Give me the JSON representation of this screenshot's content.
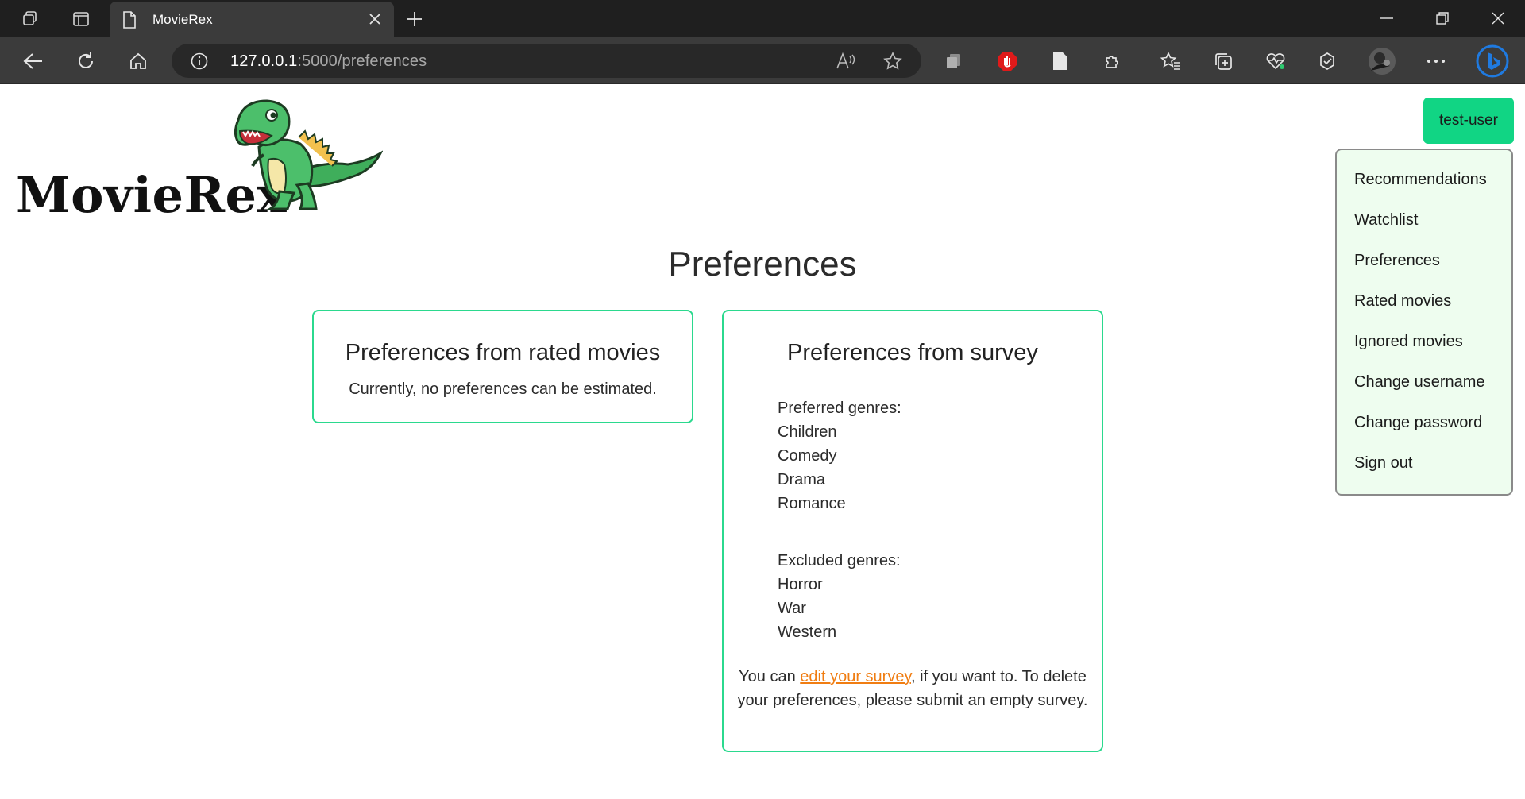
{
  "browser": {
    "tab_title": "MovieRex",
    "url_host": "127.0.0.1",
    "url_rest": ":5000/preferences"
  },
  "site": {
    "logo_text": "MovieRex",
    "user_button": "test-user"
  },
  "user_menu": {
    "items": [
      {
        "label": "Recommendations"
      },
      {
        "label": "Watchlist"
      },
      {
        "label": "Preferences"
      },
      {
        "label": "Rated movies"
      },
      {
        "label": "Ignored movies"
      },
      {
        "label": "Change username"
      },
      {
        "label": "Change password"
      },
      {
        "label": "Sign out"
      }
    ]
  },
  "main": {
    "title": "Preferences",
    "rated_card": {
      "title": "Preferences from rated movies",
      "message": "Currently, no preferences can be estimated."
    },
    "survey_card": {
      "title": "Preferences from survey",
      "preferred_label": "Preferred genres:",
      "preferred": [
        "Children",
        "Comedy",
        "Drama",
        "Romance"
      ],
      "excluded_label": "Excluded genres:",
      "excluded": [
        "Horror",
        "War",
        "Western"
      ],
      "note_before": "You can ",
      "note_link": "edit your survey",
      "note_after": ", if you want to. To delete your preferences, please submit an empty survey."
    }
  },
  "colors": {
    "accent": "#11d584",
    "card_border": "#2bd98e",
    "link": "#f07d12",
    "menu_bg": "#eefdef"
  }
}
